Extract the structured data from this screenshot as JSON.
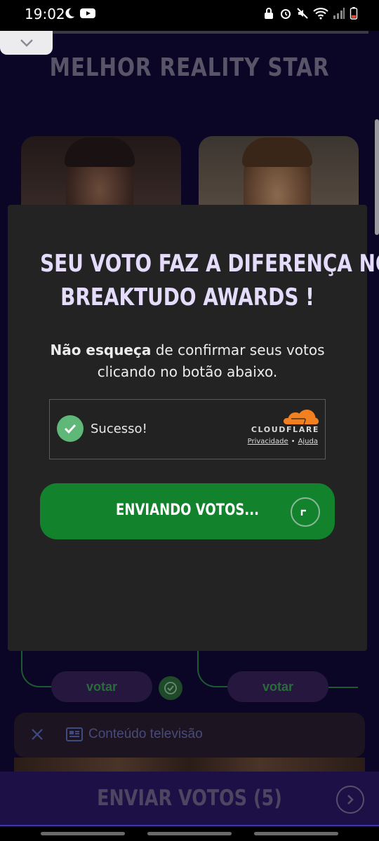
{
  "status_bar": {
    "time": "19:02",
    "left_icons": [
      "moon-icon",
      "youtube-icon"
    ],
    "right_icons": [
      "lock-icon",
      "alarm-icon",
      "mute-icon",
      "wifi-icon",
      "signal-icon",
      "battery-icon"
    ]
  },
  "page": {
    "title": "MELHOR REALITY STAR",
    "vote_labels": [
      "votar",
      "votar"
    ],
    "info_bar": {
      "text": "Conteúdo televisão"
    },
    "footer": {
      "send_label": "ENVIAR VOTOS (5)"
    }
  },
  "dialog": {
    "title_line1": "SEU VOTO FAZ A DIFERENÇA NO",
    "title_line2": "BREAKTUDO AWARDS !",
    "body_bold": "Não esqueça",
    "body_rest_line1": " de confirmar seus votos",
    "body_line2": "clicando no botão abaixo.",
    "turnstile": {
      "status": "Sucesso!",
      "brand": "CLOUDFLARE",
      "privacy_link": "Privacidade",
      "help_link": "Ajuda"
    },
    "send_button_label": "ENVIANDO VOTOS..."
  },
  "colors": {
    "background": "#0c0626",
    "dialog": "#232323",
    "title": "#e4dcfa",
    "send_button": "#13822c",
    "success_check": "#5fb878",
    "cloudflare_orange": "#f38020"
  }
}
